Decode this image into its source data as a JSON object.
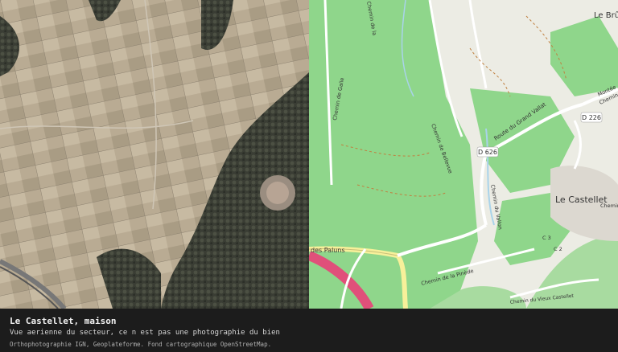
{
  "caption": {
    "title": "Le Castellet, maison",
    "subtitle": "Vue aerienne du secteur, ce n est pas une photographie du bien",
    "credits": "Orthophotographie IGN, Geoplateforme. Fond cartographique OpenStreetMap."
  },
  "map": {
    "town_label": "Le Castellet",
    "town_label_ne": "Le Brûl",
    "road_d226": "D 226",
    "road_d626": "D 626",
    "road_grand_vallat": "Route du Grand Vallat",
    "road_paluns": "des Paluns",
    "road_pinede": "Chemin de la Pinède",
    "road_bellevue": "Chemin de Bellevue",
    "road_galle": "Chemin de Galle",
    "road_vallon": "Chemin du Vallon",
    "road_vieux_castellet": "Chemin du Vieux Castellet",
    "road_montee": "Montée",
    "road_colombes": "Chemin",
    "road_c1": "C 3",
    "road_c2": "C 2",
    "road_chemin_ne": "Chemin",
    "road_cheminette": "Chemin de la",
    "colors": {
      "vineyard": "#8fd68b",
      "vineyard_line": "#6fc26a",
      "background": "#ecece4",
      "forest": "#a8dba0",
      "road_main": "#f7f09a",
      "road_red": "#e0507a",
      "water": "#a9d3ea"
    }
  }
}
